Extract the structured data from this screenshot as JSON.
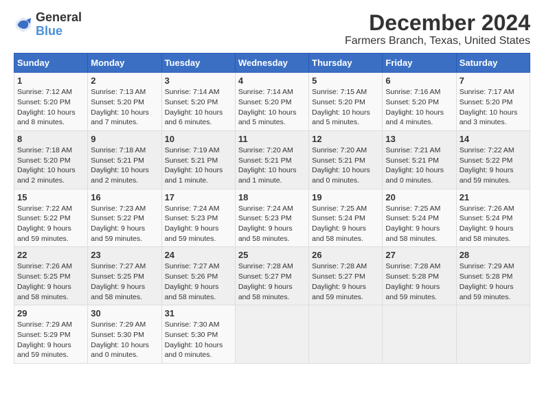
{
  "header": {
    "logo_general": "General",
    "logo_blue": "Blue",
    "month_title": "December 2024",
    "location": "Farmers Branch, Texas, United States"
  },
  "days_of_week": [
    "Sunday",
    "Monday",
    "Tuesday",
    "Wednesday",
    "Thursday",
    "Friday",
    "Saturday"
  ],
  "weeks": [
    [
      {
        "day": "1",
        "sunrise": "Sunrise: 7:12 AM",
        "sunset": "Sunset: 5:20 PM",
        "daylight": "Daylight: 10 hours and 8 minutes."
      },
      {
        "day": "2",
        "sunrise": "Sunrise: 7:13 AM",
        "sunset": "Sunset: 5:20 PM",
        "daylight": "Daylight: 10 hours and 7 minutes."
      },
      {
        "day": "3",
        "sunrise": "Sunrise: 7:14 AM",
        "sunset": "Sunset: 5:20 PM",
        "daylight": "Daylight: 10 hours and 6 minutes."
      },
      {
        "day": "4",
        "sunrise": "Sunrise: 7:14 AM",
        "sunset": "Sunset: 5:20 PM",
        "daylight": "Daylight: 10 hours and 5 minutes."
      },
      {
        "day": "5",
        "sunrise": "Sunrise: 7:15 AM",
        "sunset": "Sunset: 5:20 PM",
        "daylight": "Daylight: 10 hours and 5 minutes."
      },
      {
        "day": "6",
        "sunrise": "Sunrise: 7:16 AM",
        "sunset": "Sunset: 5:20 PM",
        "daylight": "Daylight: 10 hours and 4 minutes."
      },
      {
        "day": "7",
        "sunrise": "Sunrise: 7:17 AM",
        "sunset": "Sunset: 5:20 PM",
        "daylight": "Daylight: 10 hours and 3 minutes."
      }
    ],
    [
      {
        "day": "8",
        "sunrise": "Sunrise: 7:18 AM",
        "sunset": "Sunset: 5:20 PM",
        "daylight": "Daylight: 10 hours and 2 minutes."
      },
      {
        "day": "9",
        "sunrise": "Sunrise: 7:18 AM",
        "sunset": "Sunset: 5:21 PM",
        "daylight": "Daylight: 10 hours and 2 minutes."
      },
      {
        "day": "10",
        "sunrise": "Sunrise: 7:19 AM",
        "sunset": "Sunset: 5:21 PM",
        "daylight": "Daylight: 10 hours and 1 minute."
      },
      {
        "day": "11",
        "sunrise": "Sunrise: 7:20 AM",
        "sunset": "Sunset: 5:21 PM",
        "daylight": "Daylight: 10 hours and 1 minute."
      },
      {
        "day": "12",
        "sunrise": "Sunrise: 7:20 AM",
        "sunset": "Sunset: 5:21 PM",
        "daylight": "Daylight: 10 hours and 0 minutes."
      },
      {
        "day": "13",
        "sunrise": "Sunrise: 7:21 AM",
        "sunset": "Sunset: 5:21 PM",
        "daylight": "Daylight: 10 hours and 0 minutes."
      },
      {
        "day": "14",
        "sunrise": "Sunrise: 7:22 AM",
        "sunset": "Sunset: 5:22 PM",
        "daylight": "Daylight: 9 hours and 59 minutes."
      }
    ],
    [
      {
        "day": "15",
        "sunrise": "Sunrise: 7:22 AM",
        "sunset": "Sunset: 5:22 PM",
        "daylight": "Daylight: 9 hours and 59 minutes."
      },
      {
        "day": "16",
        "sunrise": "Sunrise: 7:23 AM",
        "sunset": "Sunset: 5:22 PM",
        "daylight": "Daylight: 9 hours and 59 minutes."
      },
      {
        "day": "17",
        "sunrise": "Sunrise: 7:24 AM",
        "sunset": "Sunset: 5:23 PM",
        "daylight": "Daylight: 9 hours and 59 minutes."
      },
      {
        "day": "18",
        "sunrise": "Sunrise: 7:24 AM",
        "sunset": "Sunset: 5:23 PM",
        "daylight": "Daylight: 9 hours and 58 minutes."
      },
      {
        "day": "19",
        "sunrise": "Sunrise: 7:25 AM",
        "sunset": "Sunset: 5:24 PM",
        "daylight": "Daylight: 9 hours and 58 minutes."
      },
      {
        "day": "20",
        "sunrise": "Sunrise: 7:25 AM",
        "sunset": "Sunset: 5:24 PM",
        "daylight": "Daylight: 9 hours and 58 minutes."
      },
      {
        "day": "21",
        "sunrise": "Sunrise: 7:26 AM",
        "sunset": "Sunset: 5:24 PM",
        "daylight": "Daylight: 9 hours and 58 minutes."
      }
    ],
    [
      {
        "day": "22",
        "sunrise": "Sunrise: 7:26 AM",
        "sunset": "Sunset: 5:25 PM",
        "daylight": "Daylight: 9 hours and 58 minutes."
      },
      {
        "day": "23",
        "sunrise": "Sunrise: 7:27 AM",
        "sunset": "Sunset: 5:25 PM",
        "daylight": "Daylight: 9 hours and 58 minutes."
      },
      {
        "day": "24",
        "sunrise": "Sunrise: 7:27 AM",
        "sunset": "Sunset: 5:26 PM",
        "daylight": "Daylight: 9 hours and 58 minutes."
      },
      {
        "day": "25",
        "sunrise": "Sunrise: 7:28 AM",
        "sunset": "Sunset: 5:27 PM",
        "daylight": "Daylight: 9 hours and 58 minutes."
      },
      {
        "day": "26",
        "sunrise": "Sunrise: 7:28 AM",
        "sunset": "Sunset: 5:27 PM",
        "daylight": "Daylight: 9 hours and 59 minutes."
      },
      {
        "day": "27",
        "sunrise": "Sunrise: 7:28 AM",
        "sunset": "Sunset: 5:28 PM",
        "daylight": "Daylight: 9 hours and 59 minutes."
      },
      {
        "day": "28",
        "sunrise": "Sunrise: 7:29 AM",
        "sunset": "Sunset: 5:28 PM",
        "daylight": "Daylight: 9 hours and 59 minutes."
      }
    ],
    [
      {
        "day": "29",
        "sunrise": "Sunrise: 7:29 AM",
        "sunset": "Sunset: 5:29 PM",
        "daylight": "Daylight: 9 hours and 59 minutes."
      },
      {
        "day": "30",
        "sunrise": "Sunrise: 7:29 AM",
        "sunset": "Sunset: 5:30 PM",
        "daylight": "Daylight: 10 hours and 0 minutes."
      },
      {
        "day": "31",
        "sunrise": "Sunrise: 7:30 AM",
        "sunset": "Sunset: 5:30 PM",
        "daylight": "Daylight: 10 hours and 0 minutes."
      },
      null,
      null,
      null,
      null
    ]
  ]
}
